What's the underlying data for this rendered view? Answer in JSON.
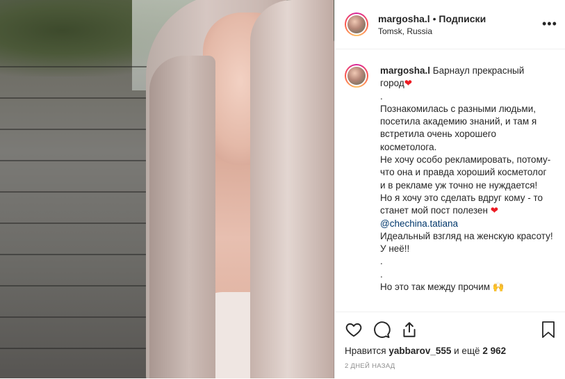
{
  "post": {
    "username": "margosha.l",
    "separator": " • ",
    "follow_label": "Подписки",
    "location": "Tomsk, Russia",
    "more_label": "•••"
  },
  "caption": {
    "username": "margosha.l",
    "lines": [
      "Барнаул прекрасный",
      "город",
      ".",
      "Познакомилась с разными людьми, посетила академию знаний, и там я встретила очень хорошего косметолога.",
      "Не хочу особо рекламировать, потому- что она и правда хороший косметолог и в рекламе уж точно не нуждается!",
      "Но я хочу это сделать вдруг кому - то станет мой пост полезен",
      "@chechina.tatiana",
      "Идеальный взгляд на женскую красоту! У неё!!",
      ".",
      ".",
      "Но это так между прочим"
    ],
    "heart_emoji": "❤",
    "hands_emoji": "🙌"
  },
  "actions": {
    "like_icon": "heart-icon",
    "comment_icon": "comment-icon",
    "share_icon": "share-icon",
    "save_icon": "bookmark-icon"
  },
  "likes": {
    "prefix": "Нравится ",
    "user": "yabbarov_555",
    "middle": " и ещё ",
    "count": "2 962"
  },
  "date": "2 ДНЕЙ НАЗАД",
  "colors": {
    "text": "#262626",
    "muted": "#8e8e8e",
    "link": "#00376b",
    "heart": "#ed1c24",
    "border": "#efefef"
  }
}
